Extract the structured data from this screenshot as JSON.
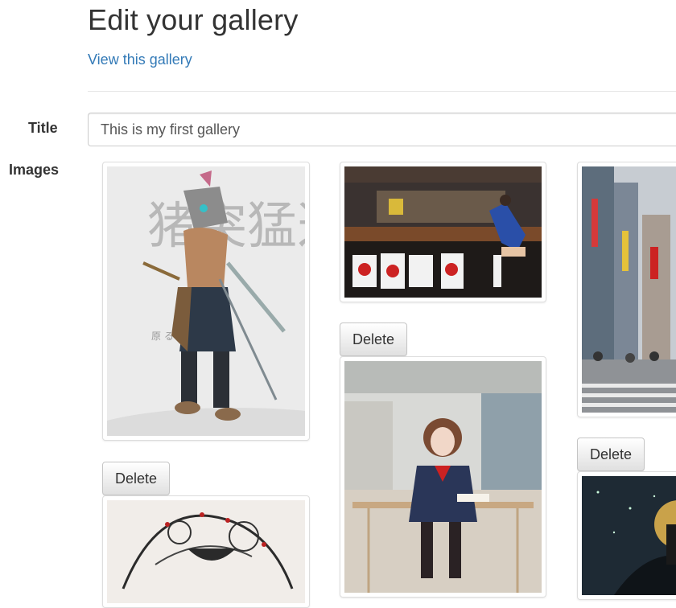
{
  "header": {
    "title": "Edit your gallery",
    "view_link": "View this gallery"
  },
  "form": {
    "title_label": "Title",
    "title_value": "This is my first gallery",
    "images_label": "Images"
  },
  "images": [
    {
      "kind": "robot-samurai-illustration",
      "delete_label": "Delete"
    },
    {
      "kind": "ramen-shop-cosplay-photo",
      "delete_label": "Delete"
    },
    {
      "kind": "city-street-photo",
      "delete_label": "Delete"
    },
    {
      "kind": "ink-geisha-illustration"
    },
    {
      "kind": "schoolgirl-library-photo"
    },
    {
      "kind": "dark-night-illustration"
    }
  ],
  "art_text": {
    "kanji_large": "猪突猛進",
    "kanji_small": "原 る"
  },
  "colors": {
    "link": "#337ab7",
    "border": "#dddddd"
  }
}
